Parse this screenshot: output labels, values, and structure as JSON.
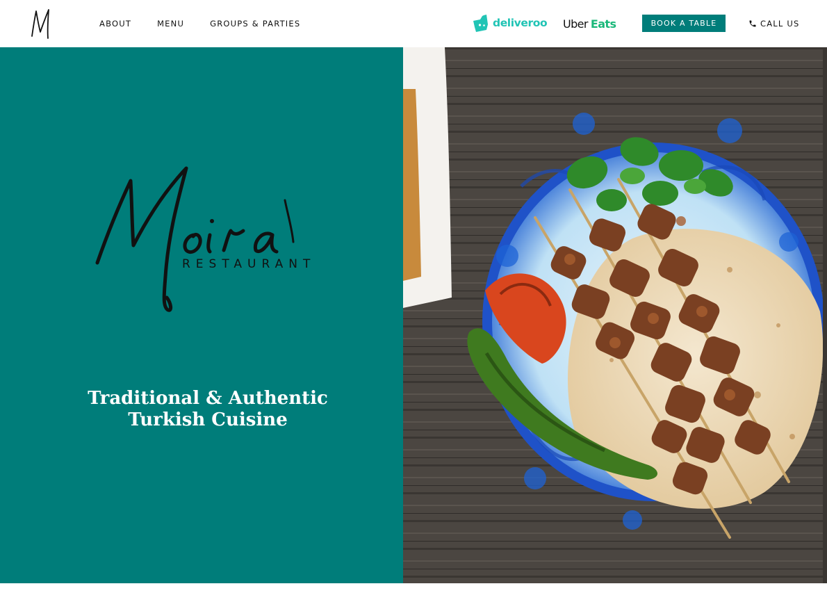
{
  "header": {
    "nav": {
      "about": "ABOUT",
      "menu": "MENU",
      "groups": "GROUPS & PARTIES"
    },
    "delivery": {
      "deliveroo": "deliveroo",
      "uber": "Uber",
      "eats": "Eats"
    },
    "book_label": "BOOK A TABLE",
    "call_label": "CALL US"
  },
  "hero": {
    "brand_sub": "RESTAURANT",
    "tagline_line1": "Traditional & Authentic",
    "tagline_line2": "Turkish Cuisine"
  },
  "colors": {
    "brand_teal": "#007d7a",
    "deliveroo": "#21c4b5",
    "uber_eats": "#1bb87a"
  },
  "icons": {
    "monogram": "monogram-logo-icon",
    "deliveroo": "deliveroo-kangaroo-icon",
    "phone": "phone-icon"
  }
}
